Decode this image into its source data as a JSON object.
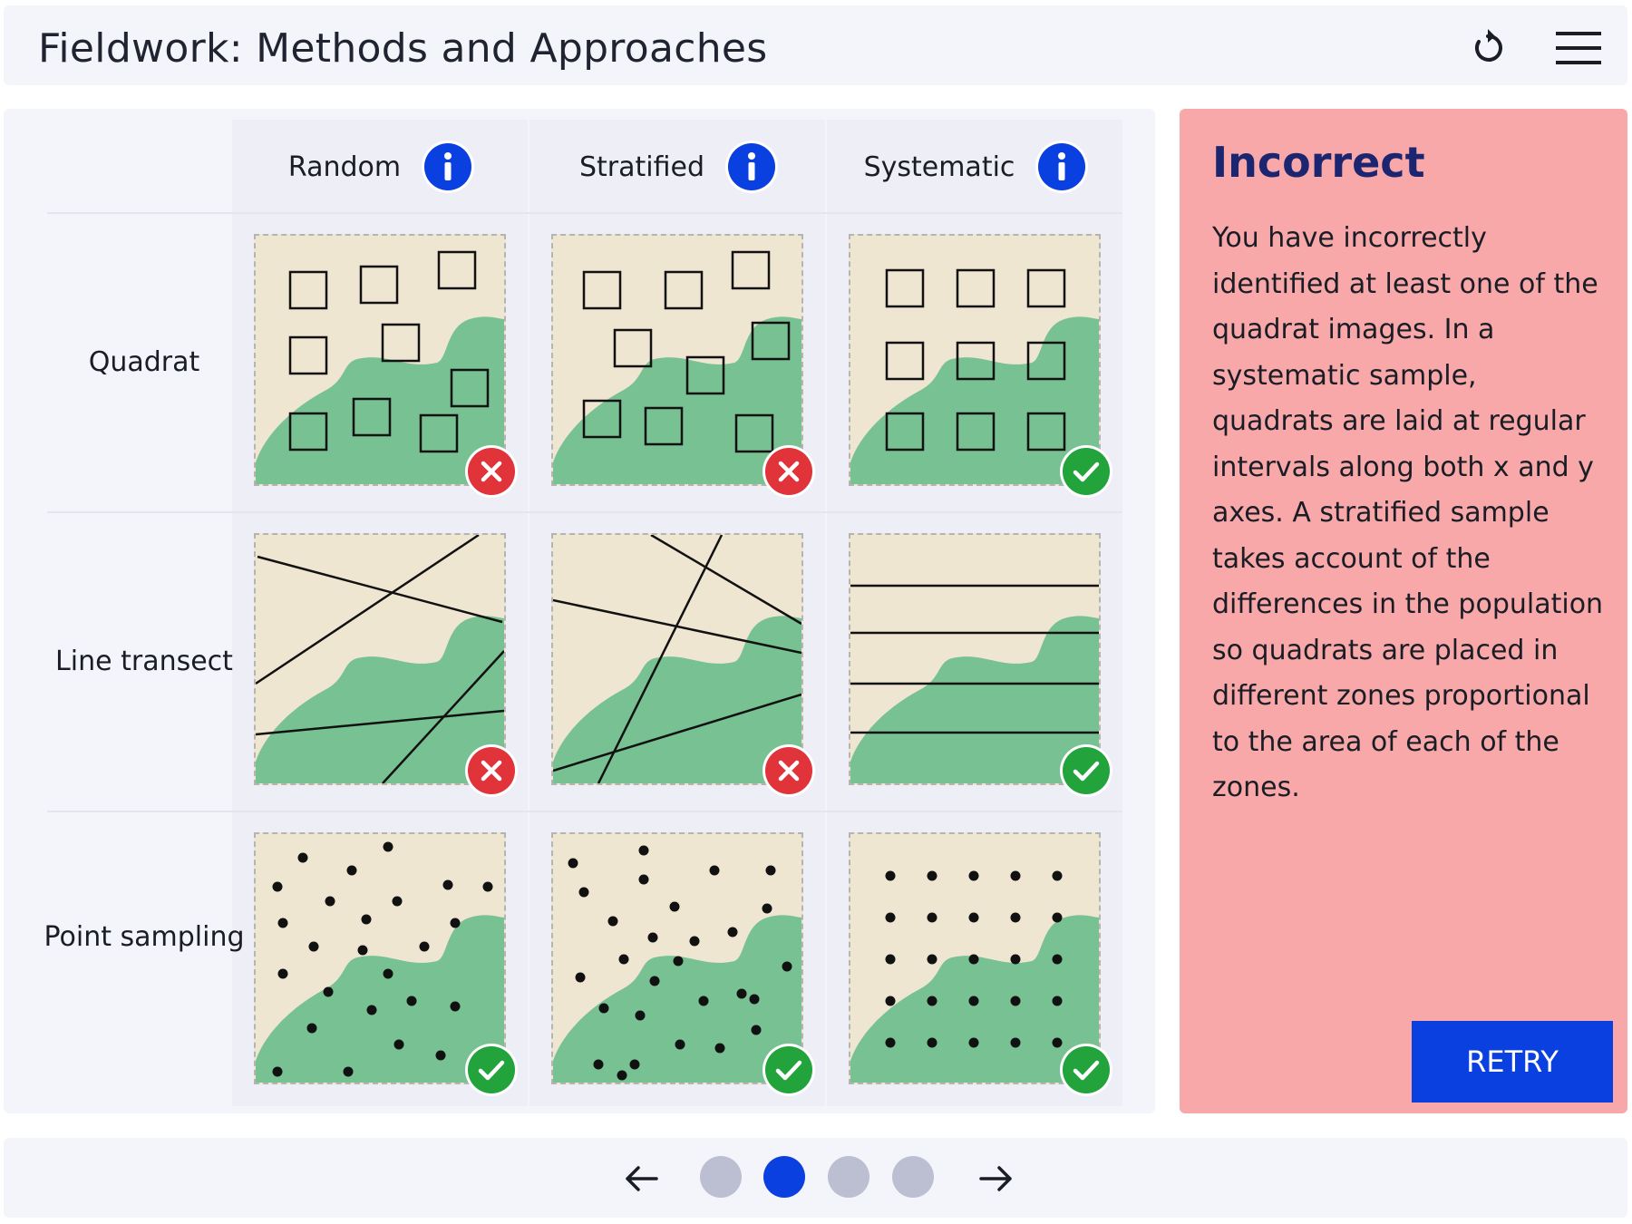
{
  "header": {
    "title": "Fieldwork: Methods and Approaches",
    "reset_icon": "reset-icon",
    "menu_icon": "hamburger-menu-icon"
  },
  "columns": [
    {
      "label": "Random",
      "icon": "info-icon"
    },
    {
      "label": "Stratified",
      "icon": "info-icon"
    },
    {
      "label": "Systematic",
      "icon": "info-icon"
    }
  ],
  "rows": [
    {
      "label": "Quadrat"
    },
    {
      "label": "Line transect"
    },
    {
      "label": "Point sampling"
    }
  ],
  "cells": [
    [
      {
        "status": "incorrect",
        "icon": "cross-icon"
      },
      {
        "status": "incorrect",
        "icon": "cross-icon"
      },
      {
        "status": "correct",
        "icon": "check-icon"
      }
    ],
    [
      {
        "status": "incorrect",
        "icon": "cross-icon"
      },
      {
        "status": "incorrect",
        "icon": "cross-icon"
      },
      {
        "status": "correct",
        "icon": "check-icon"
      }
    ],
    [
      {
        "status": "correct",
        "icon": "check-icon"
      },
      {
        "status": "correct",
        "icon": "check-icon"
      },
      {
        "status": "correct",
        "icon": "check-icon"
      }
    ]
  ],
  "feedback": {
    "heading": "Incorrect",
    "text": "You have incorrectly identified at least one of the quadrat images. In a systematic sample, quadrats are laid at regular intervals along both x and y axes. A stratified sample takes account of the differences in the population so quadrats are placed in different zones proportional to the area of each of the zones.",
    "retry_label": "RETRY"
  },
  "pagination": {
    "total_pages": 4,
    "current_page": 2,
    "prev_icon": "arrow-left-icon",
    "next_icon": "arrow-right-icon"
  },
  "colors": {
    "accent": "#0a40e0",
    "feedback_bg": "#f8a8a8",
    "heading": "#1c2570",
    "land": "#efe6d2",
    "vegetation": "#77c192",
    "correct": "#22a33c",
    "incorrect": "#e0343a",
    "dot_inactive": "#bcbfd2"
  }
}
